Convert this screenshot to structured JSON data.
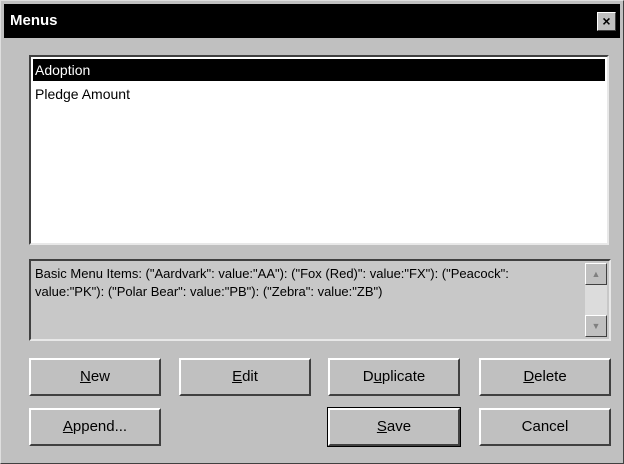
{
  "window": {
    "title": "Menus",
    "close_glyph": "×"
  },
  "menu_list": {
    "items": [
      {
        "label": "Adoption",
        "selected": true
      },
      {
        "label": "Pledge Amount",
        "selected": false
      }
    ]
  },
  "description": {
    "text": "Basic Menu Items: (\"Aardvark\": value:\"AA\"): (\"Fox (Red)\": value:\"FX\"): (\"Peacock\": value:\"PK\"): (\"Polar Bear\": value:\"PB\"): (\"Zebra\": value:\"ZB\")",
    "scroll_up_glyph": "▲",
    "scroll_down_glyph": "▼"
  },
  "buttons": {
    "new": {
      "pre": "",
      "accel": "N",
      "post": "ew"
    },
    "edit": {
      "pre": "",
      "accel": "E",
      "post": "dit"
    },
    "duplicate": {
      "pre": "D",
      "accel": "u",
      "post": "plicate"
    },
    "delete": {
      "pre": "",
      "accel": "D",
      "post": "elete"
    },
    "append": {
      "pre": "",
      "accel": "A",
      "post": "ppend..."
    },
    "save": {
      "pre": "",
      "accel": "S",
      "post": "ave"
    },
    "cancel": {
      "pre": "Cancel",
      "accel": "",
      "post": ""
    }
  }
}
